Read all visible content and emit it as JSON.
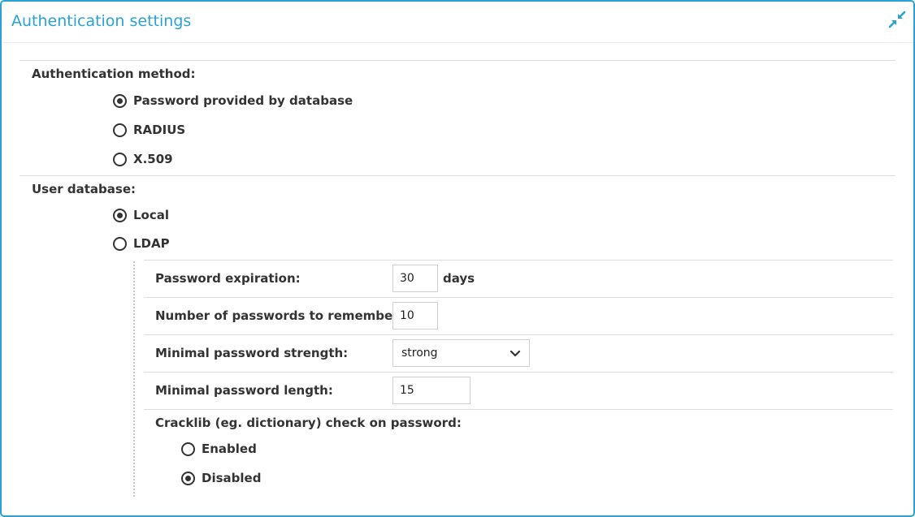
{
  "panel": {
    "title": "Authentication settings",
    "collapse_icon": "collapse-arrows-icon",
    "accent_color": "#29a3d6"
  },
  "auth_method": {
    "label": "Authentication method:",
    "options": [
      {
        "label": "Password provided by database",
        "checked": true
      },
      {
        "label": "RADIUS",
        "checked": false
      },
      {
        "label": "X.509",
        "checked": false
      }
    ]
  },
  "user_db": {
    "label": "User database:",
    "options": [
      {
        "label": "Local",
        "checked": true
      },
      {
        "label": "LDAP",
        "checked": false
      }
    ]
  },
  "local_settings": {
    "password_expiration": {
      "label": "Password expiration:",
      "value": "30",
      "unit": "days"
    },
    "passwords_remember": {
      "label": "Number of passwords to remember:",
      "value": "10"
    },
    "min_strength": {
      "label": "Minimal password strength:",
      "value": "strong"
    },
    "min_length": {
      "label": "Minimal password length:",
      "value": "15"
    },
    "cracklib": {
      "label": "Cracklib (eg. dictionary) check on password:",
      "options": [
        {
          "label": "Enabled",
          "checked": false
        },
        {
          "label": "Disabled",
          "checked": true
        }
      ]
    }
  }
}
